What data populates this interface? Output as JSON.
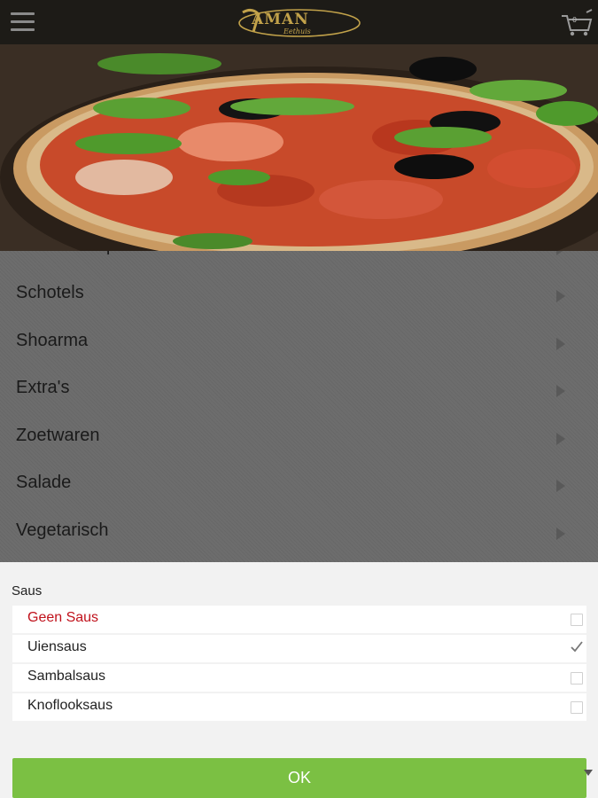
{
  "header": {
    "menu_icon": "hamburger-menu-icon",
    "logo_text": "AMAN",
    "logo_sub": "Eethuis",
    "cart_icon": "shopping-cart-icon",
    "cart_count": "0"
  },
  "hero": {
    "image": "pizza-photo"
  },
  "menu": {
    "items": [
      {
        "label": "Durum/Wrap"
      },
      {
        "label": "Schotels"
      },
      {
        "label": "Shoarma"
      },
      {
        "label": "Extra's"
      },
      {
        "label": "Zoetwaren"
      },
      {
        "label": "Salade"
      },
      {
        "label": "Vegetarisch"
      }
    ],
    "arrow_icon": "chevron-right-icon"
  },
  "sheet": {
    "title": "Saus",
    "options": [
      {
        "label": "Geen Saus",
        "checked": false,
        "color": "#c0111b"
      },
      {
        "label": "Uiensaus",
        "checked": true
      },
      {
        "label": "Sambalsaus",
        "checked": false
      },
      {
        "label": "Knoflooksaus",
        "checked": false
      }
    ],
    "ok_label": "OK",
    "ok_color": "#7bc043"
  }
}
